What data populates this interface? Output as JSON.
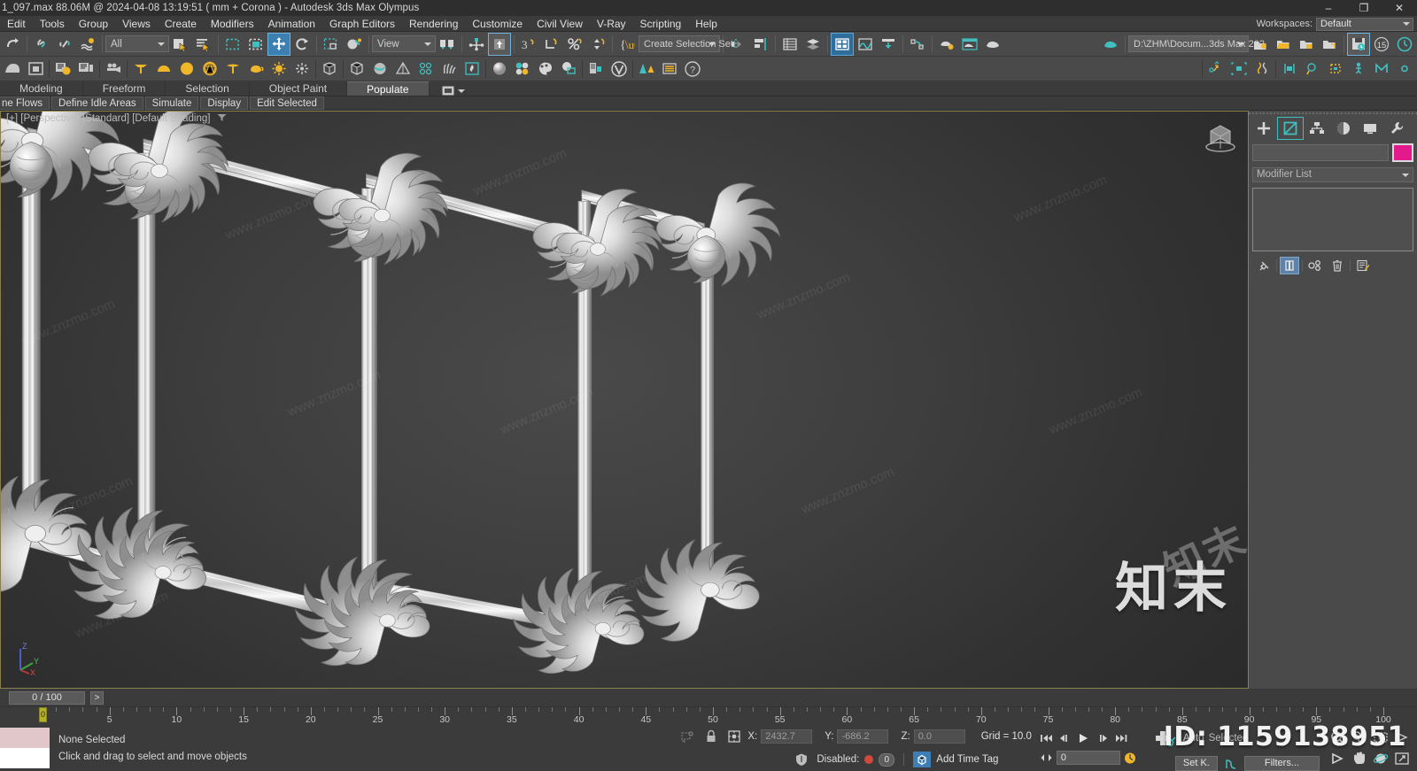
{
  "window": {
    "title": "1_097.max  88.06M @ 2024-04-08 13:19:51  ( mm + Corona ) - Autodesk 3ds Max Olympus",
    "minimize": "–",
    "maximize": "❐",
    "close": "✕"
  },
  "menu": {
    "items": [
      "Edit",
      "Tools",
      "Group",
      "Views",
      "Create",
      "Modifiers",
      "Animation",
      "Graph Editors",
      "Rendering",
      "Customize",
      "Civil View",
      "V-Ray",
      "Scripting",
      "Help"
    ],
    "workspaces_label": "Workspaces:",
    "workspaces_value": "Default"
  },
  "toolbar": {
    "selection_filter": "All",
    "reference_coord": "View",
    "selection_set": "Create Selection Set",
    "project_folder": "D:\\ZHM\\Docum...3ds Max 202",
    "undo_levels": "15",
    "icons_row1": [
      "redo-icon",
      "select-link-icon",
      "unlink-icon",
      "bind-space-warp-icon",
      "select-object-icon",
      "select-by-name-icon",
      "rectangular-select-region-icon",
      "window-crossing-icon",
      "select-and-move-icon",
      "select-and-rotate-icon",
      "select-and-scale-icon",
      "select-and-place-icon",
      "use-center-flyout-icon",
      "select-and-manipulate-icon",
      "snaps-toggle-icon",
      "angle-snap-icon",
      "percent-snap-icon",
      "spinner-snap-icon",
      "named-selection-sets-icon",
      "mirror-icon",
      "align-icon",
      "layer-explorer-icon",
      "curve-editor-icon",
      "schematic-view-icon",
      "material-editor-icon",
      "render-setup-icon",
      "rendered-frame-window-icon",
      "render-production-icon",
      "save-file-icon",
      "quick-render-icon"
    ],
    "icons_row2": [
      "arc-rotate-icon",
      "maximize-viewport-icon",
      "scene-explorer-icon",
      "layer-manager-icon",
      "camera-icon",
      "cone-icon",
      "sphere-icon",
      "geosphere-icon",
      "teapot-icon",
      "box-icon",
      "plane-icon",
      "sunlight-icon",
      "light-icon",
      "helper-icon",
      "spacewarp-icon",
      "compound-icon",
      "particle-icon",
      "hair-icon",
      "fire-icon",
      "material-sphere-icon",
      "material-browser-icon",
      "palette-icon",
      "bitmap-icon",
      "asset-tracking-icon",
      "vray-icon",
      "forest-pack-icon",
      "railclone-icon",
      "help-icon"
    ]
  },
  "ribbon": {
    "tabs": [
      "Modeling",
      "Freeform",
      "Selection",
      "Object Paint",
      "Populate"
    ],
    "selected_tab": "Populate",
    "row_buttons": [
      "ne Flows",
      "Define Idle Areas",
      "Simulate",
      "Display",
      "Edit Selected"
    ]
  },
  "viewport": {
    "label": "[+] [Perspective] [Standard] [Default Shading]",
    "axis": {
      "x": "X",
      "y": "Y",
      "z": "Z"
    },
    "model_description": "Ornate baroque decorative picture frames / wall molding panels in white/silver shaded material"
  },
  "command_panel": {
    "tabs": [
      "create-tab-icon",
      "modify-tab-icon",
      "hierarchy-tab-icon",
      "motion-tab-icon",
      "display-tab-icon",
      "utilities-tab-icon"
    ],
    "selected_tab": "modify-tab-icon",
    "object_name": "",
    "color_swatch": "#e21a8c",
    "modifier_list": "Modifier List",
    "stack_buttons": [
      "pin-stack-icon",
      "show-end-result-icon",
      "make-unique-icon",
      "remove-modifier-icon",
      "configure-modifier-sets-icon"
    ]
  },
  "timeline": {
    "frame_display": "0 / 100",
    "next_btn": ">",
    "current_frame": "0",
    "ticks": [
      0,
      5,
      10,
      15,
      20,
      25,
      30,
      35,
      40,
      45,
      50,
      55,
      60,
      65,
      70,
      75,
      80,
      85,
      90,
      95,
      100
    ],
    "playhead_label": "0"
  },
  "status": {
    "selection": "None Selected",
    "prompt": "Click and drag to select and move objects",
    "x_label": "X:",
    "x_value": "2432.7",
    "y_label": "Y:",
    "y_value": "-686.2",
    "z_label": "Z:",
    "z_value": "0.0",
    "grid": "Grid = 10.0",
    "disabled_label": "Disabled:",
    "disabled_count": "0",
    "add_time_tag": "Add Time Tag",
    "auto_key": "Auto",
    "set_key": "Set K.",
    "selected_label": "Selected",
    "filters": "Filters...",
    "key_filters_spin": "0"
  },
  "watermarks": {
    "site": "www.znzmo.com",
    "brand": "知末",
    "id": "ID: 1159138951"
  }
}
